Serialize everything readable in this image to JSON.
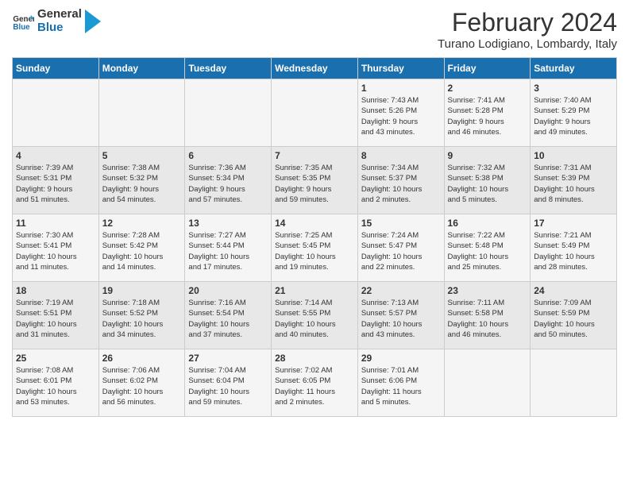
{
  "header": {
    "logo_line1": "General",
    "logo_line2": "Blue",
    "main_title": "February 2024",
    "sub_title": "Turano Lodigiano, Lombardy, Italy"
  },
  "calendar": {
    "days_of_week": [
      "Sunday",
      "Monday",
      "Tuesday",
      "Wednesday",
      "Thursday",
      "Friday",
      "Saturday"
    ],
    "weeks": [
      [
        {
          "day": "",
          "info": ""
        },
        {
          "day": "",
          "info": ""
        },
        {
          "day": "",
          "info": ""
        },
        {
          "day": "",
          "info": ""
        },
        {
          "day": "1",
          "info": "Sunrise: 7:43 AM\nSunset: 5:26 PM\nDaylight: 9 hours\nand 43 minutes."
        },
        {
          "day": "2",
          "info": "Sunrise: 7:41 AM\nSunset: 5:28 PM\nDaylight: 9 hours\nand 46 minutes."
        },
        {
          "day": "3",
          "info": "Sunrise: 7:40 AM\nSunset: 5:29 PM\nDaylight: 9 hours\nand 49 minutes."
        }
      ],
      [
        {
          "day": "4",
          "info": "Sunrise: 7:39 AM\nSunset: 5:31 PM\nDaylight: 9 hours\nand 51 minutes."
        },
        {
          "day": "5",
          "info": "Sunrise: 7:38 AM\nSunset: 5:32 PM\nDaylight: 9 hours\nand 54 minutes."
        },
        {
          "day": "6",
          "info": "Sunrise: 7:36 AM\nSunset: 5:34 PM\nDaylight: 9 hours\nand 57 minutes."
        },
        {
          "day": "7",
          "info": "Sunrise: 7:35 AM\nSunset: 5:35 PM\nDaylight: 9 hours\nand 59 minutes."
        },
        {
          "day": "8",
          "info": "Sunrise: 7:34 AM\nSunset: 5:37 PM\nDaylight: 10 hours\nand 2 minutes."
        },
        {
          "day": "9",
          "info": "Sunrise: 7:32 AM\nSunset: 5:38 PM\nDaylight: 10 hours\nand 5 minutes."
        },
        {
          "day": "10",
          "info": "Sunrise: 7:31 AM\nSunset: 5:39 PM\nDaylight: 10 hours\nand 8 minutes."
        }
      ],
      [
        {
          "day": "11",
          "info": "Sunrise: 7:30 AM\nSunset: 5:41 PM\nDaylight: 10 hours\nand 11 minutes."
        },
        {
          "day": "12",
          "info": "Sunrise: 7:28 AM\nSunset: 5:42 PM\nDaylight: 10 hours\nand 14 minutes."
        },
        {
          "day": "13",
          "info": "Sunrise: 7:27 AM\nSunset: 5:44 PM\nDaylight: 10 hours\nand 17 minutes."
        },
        {
          "day": "14",
          "info": "Sunrise: 7:25 AM\nSunset: 5:45 PM\nDaylight: 10 hours\nand 19 minutes."
        },
        {
          "day": "15",
          "info": "Sunrise: 7:24 AM\nSunset: 5:47 PM\nDaylight: 10 hours\nand 22 minutes."
        },
        {
          "day": "16",
          "info": "Sunrise: 7:22 AM\nSunset: 5:48 PM\nDaylight: 10 hours\nand 25 minutes."
        },
        {
          "day": "17",
          "info": "Sunrise: 7:21 AM\nSunset: 5:49 PM\nDaylight: 10 hours\nand 28 minutes."
        }
      ],
      [
        {
          "day": "18",
          "info": "Sunrise: 7:19 AM\nSunset: 5:51 PM\nDaylight: 10 hours\nand 31 minutes."
        },
        {
          "day": "19",
          "info": "Sunrise: 7:18 AM\nSunset: 5:52 PM\nDaylight: 10 hours\nand 34 minutes."
        },
        {
          "day": "20",
          "info": "Sunrise: 7:16 AM\nSunset: 5:54 PM\nDaylight: 10 hours\nand 37 minutes."
        },
        {
          "day": "21",
          "info": "Sunrise: 7:14 AM\nSunset: 5:55 PM\nDaylight: 10 hours\nand 40 minutes."
        },
        {
          "day": "22",
          "info": "Sunrise: 7:13 AM\nSunset: 5:57 PM\nDaylight: 10 hours\nand 43 minutes."
        },
        {
          "day": "23",
          "info": "Sunrise: 7:11 AM\nSunset: 5:58 PM\nDaylight: 10 hours\nand 46 minutes."
        },
        {
          "day": "24",
          "info": "Sunrise: 7:09 AM\nSunset: 5:59 PM\nDaylight: 10 hours\nand 50 minutes."
        }
      ],
      [
        {
          "day": "25",
          "info": "Sunrise: 7:08 AM\nSunset: 6:01 PM\nDaylight: 10 hours\nand 53 minutes."
        },
        {
          "day": "26",
          "info": "Sunrise: 7:06 AM\nSunset: 6:02 PM\nDaylight: 10 hours\nand 56 minutes."
        },
        {
          "day": "27",
          "info": "Sunrise: 7:04 AM\nSunset: 6:04 PM\nDaylight: 10 hours\nand 59 minutes."
        },
        {
          "day": "28",
          "info": "Sunrise: 7:02 AM\nSunset: 6:05 PM\nDaylight: 11 hours\nand 2 minutes."
        },
        {
          "day": "29",
          "info": "Sunrise: 7:01 AM\nSunset: 6:06 PM\nDaylight: 11 hours\nand 5 minutes."
        },
        {
          "day": "",
          "info": ""
        },
        {
          "day": "",
          "info": ""
        }
      ]
    ]
  }
}
